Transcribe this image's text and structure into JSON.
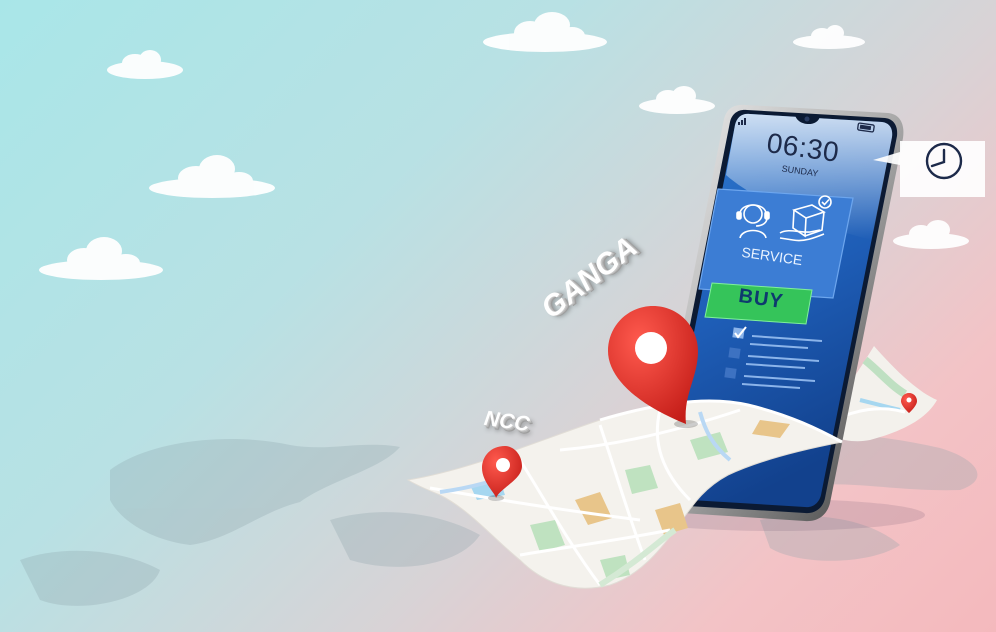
{
  "phone": {
    "time": "06:30",
    "day": "SUNDAY",
    "service_label": "SERVICE",
    "buy_label": "BUY"
  },
  "places": {
    "primary": "GANGA",
    "secondary": "NCC"
  },
  "icons": {
    "clock_bubble": "clock-icon",
    "support": "headset-support-icon",
    "delivery": "delivery-box-icon",
    "check": "checkmark-icon",
    "pins": "map-pin-icon"
  },
  "colors": {
    "sky_top": "#a9e6e8",
    "sky_bottom": "#f4b9bd",
    "screen_top": "#2f7ad1",
    "screen_bottom": "#12418d",
    "buy_button": "#35c45a",
    "pin_red": "#e8302a"
  }
}
